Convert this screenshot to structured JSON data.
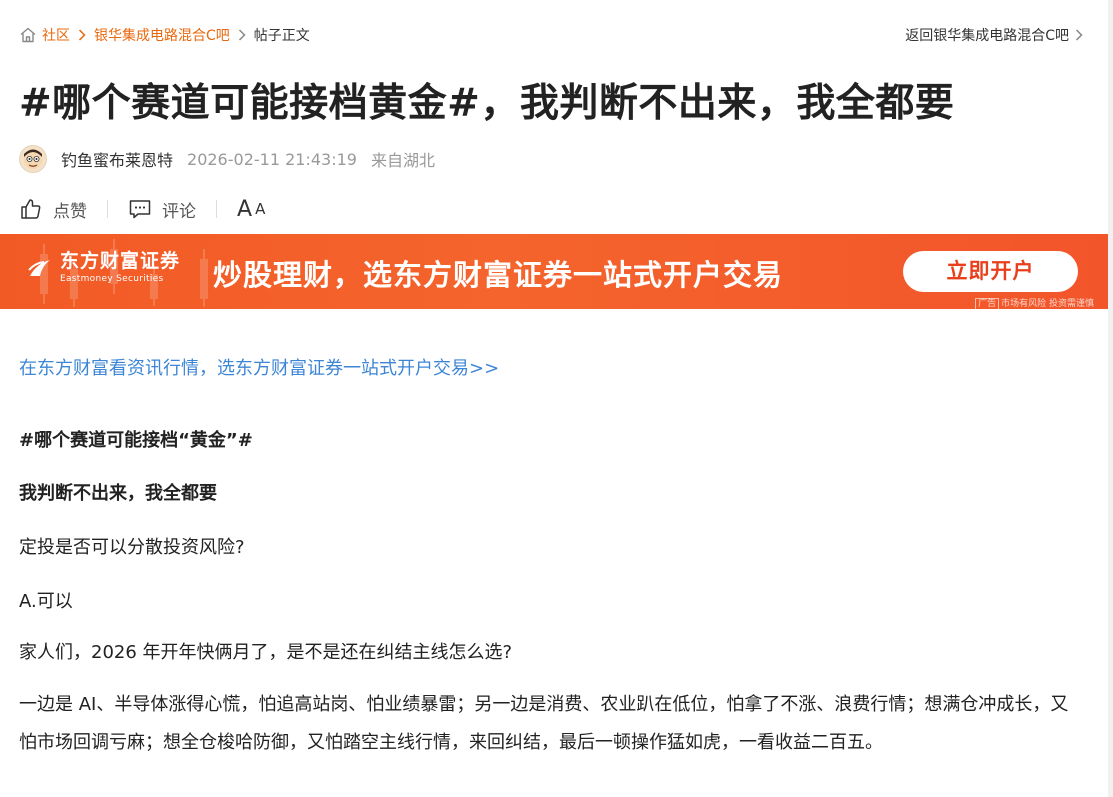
{
  "breadcrumb": {
    "items": [
      "社区",
      "银华集成电路混合C吧",
      "帖子正文"
    ],
    "back_link": "返回银华集成电路混合C吧"
  },
  "post": {
    "title": "#哪个赛道可能接档黄金#，我判断不出来，我全都要",
    "author": "钓鱼蜜布莱恩特",
    "time": "2026-02-11 21:43:19",
    "location": "来自湖北"
  },
  "actions": {
    "like_label": "点赞",
    "comment_label": "评论",
    "font_big": "A",
    "font_small": "A"
  },
  "banner": {
    "logo_cn": "东方财富证券",
    "logo_en": "Eastmoney Securities",
    "slogan": "炒股理财，选东方财富证券一站式开户交易",
    "button_label": "立即开户",
    "ad_tag": "广告",
    "note": "市场有风险 投资需谨慎"
  },
  "content": {
    "promo_link": "在东方财富看资讯行情，选东方财富证券一站式开户交易>>",
    "paragraphs": [
      "#哪个赛道可能接档“黄金”#",
      "我判断不出来，我全都要",
      "定投是否可以分散投资风险?",
      "A.可以",
      "家人们，2026 年开年快俩月了，是不是还在纠结主线怎么选?",
      "一边是 AI、半导体涨得心慌，怕追高站岗、怕业绩暴雷；另一边是消费、农业趴在低位，怕拿了不涨、浪费行情；想满仓冲成长，又怕市场回调亏麻；想全仓梭哈防御，又怕踏空主线行情，来回纠结，最后一顿操作猛如虎，一看收益二百五。"
    ]
  },
  "colors": {
    "link_orange": "#e8680e",
    "link_blue": "#3d86d6",
    "banner_orange": "#f25a25"
  }
}
